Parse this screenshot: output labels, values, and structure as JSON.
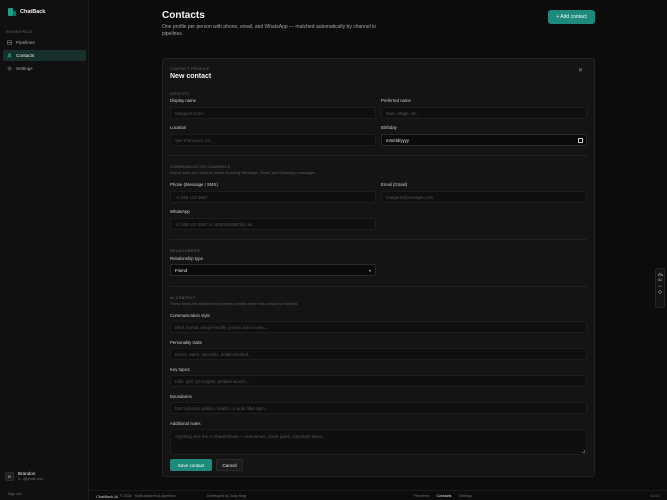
{
  "app": {
    "name": "ChatBack"
  },
  "sidebar": {
    "workspace_label": "WORKSPACE",
    "items": [
      {
        "label": "Pipelines",
        "icon": "pipelines-icon"
      },
      {
        "label": "Contacts",
        "icon": "contacts-icon",
        "active": true
      },
      {
        "label": "Settings",
        "icon": "settings-icon"
      }
    ],
    "user": {
      "initial": "B",
      "name": "Brandon",
      "email": "b...@gmail.com"
    },
    "sign_out": "Sign out"
  },
  "header": {
    "title": "Contacts",
    "subtitle": "One profile per person with phone, email, and WhatsApp — matched automatically by channel in pipelines.",
    "add_button": "+ Add contact"
  },
  "form": {
    "kicker": "CONTACT PROFILE",
    "title": "New contact",
    "identity": {
      "heading": "IDENTITY",
      "display_name": {
        "label": "Display name",
        "placeholder": "Margaret Chen"
      },
      "preferred_name": {
        "label": "Preferred name",
        "placeholder": "Mom, Mags, etc."
      },
      "location": {
        "label": "Location",
        "placeholder": "San Francisco, CA"
      },
      "birthday": {
        "label": "Birthday",
        "value": "mm/dd/yyyy"
      }
    },
    "channels": {
      "heading": "COMMUNICATION CHANNELS",
      "hint": "Add at least one. Used to match incoming iMessage, Gmail, and WhatsApp messages.",
      "phone": {
        "label": "Phone (iMessage / SMS)",
        "placeholder": "+1 555 123 4567"
      },
      "email": {
        "label": "Email (Gmail)",
        "placeholder": "margaret@example.com"
      },
      "whatsapp": {
        "label": "WhatsApp",
        "placeholder": "+1 555 123 4567 or 15551234567@c.us"
      }
    },
    "relationship": {
      "heading": "RELATIONSHIP",
      "type": {
        "label": "Relationship type",
        "value": "Friend"
      }
    },
    "ai_context": {
      "heading": "AI CONTEXT",
      "hint": "These fields are injected into pipeline prompts when this contact is matched.",
      "style": {
        "label": "Communication style",
        "placeholder": "Brief, formal, emoji-friendly, prefers voice notes..."
      },
      "traits": {
        "label": "Personality traits",
        "placeholder": "Direct, warm, sarcastic, detail-oriented..."
      },
      "topics": {
        "label": "Key topics",
        "placeholder": "Kids, golf, Q4 targets, product launch..."
      },
      "boundaries": {
        "label": "Boundaries",
        "placeholder": "Don't discuss politics, health, or work after 6pm..."
      },
      "notes": {
        "label": "Additional notes",
        "placeholder": "Anything else the AI should know — nicknames, inside jokes, important dates..."
      }
    },
    "save_button": "Save contact",
    "cancel_button": "Cancel"
  },
  "footer": {
    "brand": "ChatBack AI",
    "copyright": "© 2026 · Multi-channel AI pipelines",
    "developer": "Developed by Zody King",
    "links": [
      "Pipelines",
      "Contacts",
      "Settings"
    ],
    "active_link": "Contacts",
    "version": "v1.0.0"
  },
  "widget": {
    "count": "41",
    "unit": "ms"
  },
  "colors": {
    "accent": "#1d8a7b",
    "background": "#0c0c0c",
    "card": "#141414"
  }
}
